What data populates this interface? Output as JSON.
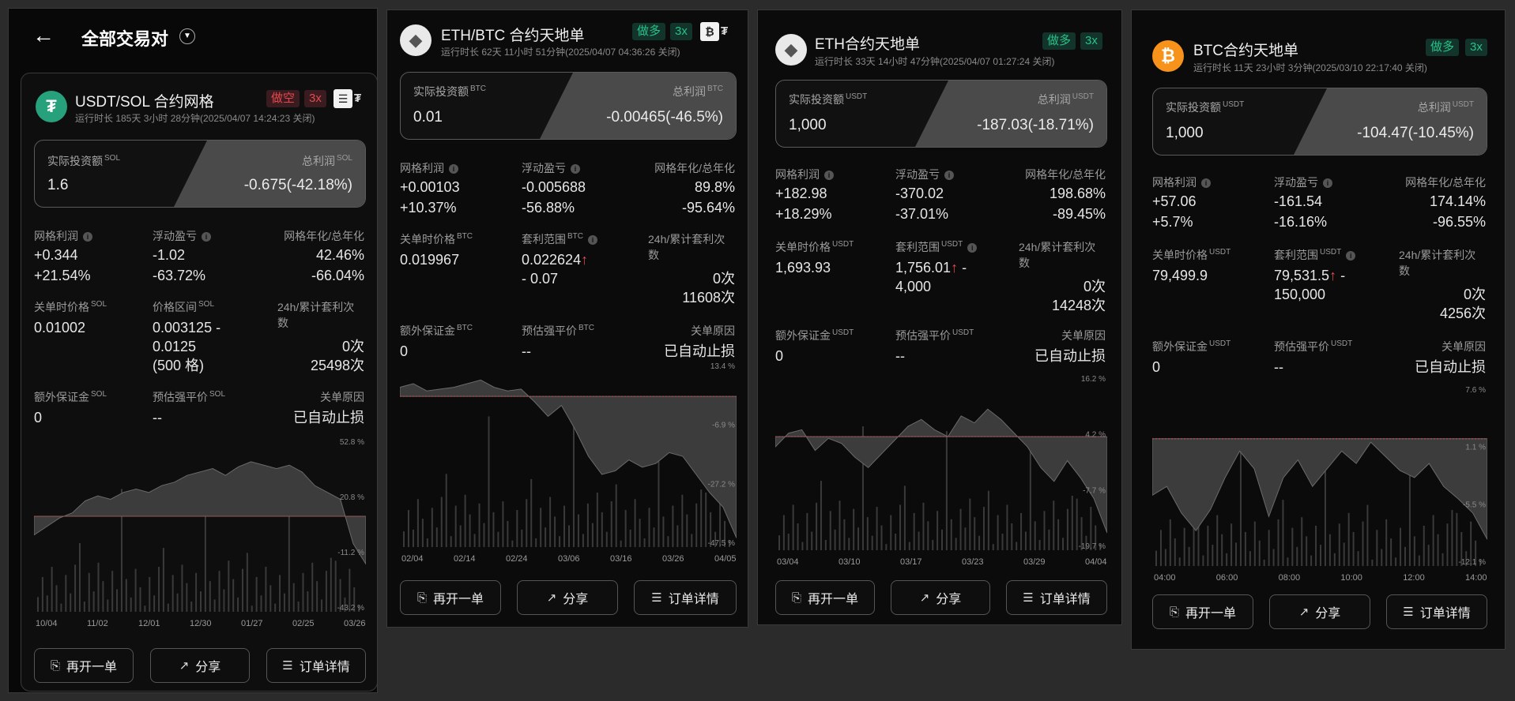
{
  "header": {
    "back_icon": "arrow-left-icon",
    "title": "全部交易对",
    "dropdown_icon": "caret-down-icon"
  },
  "cards": [
    {
      "pair": "USDT/SOL 合约网格",
      "runtime": "运行时长 185天 3小时 28分钟(2025/04/07 14:24:23 关闭)",
      "direction": "做空",
      "leverage": "3x",
      "invest_label": "实际投资额",
      "invest_unit": "SOL",
      "invest_value": "1.6",
      "profit_label": "总利润",
      "profit_unit": "SOL",
      "profit_value": "-0.675(-42.18%)",
      "grid_profit_label": "网格利润",
      "grid_profit_1": "+0.344",
      "grid_profit_2": "+21.54%",
      "float_label": "浮动盈亏",
      "float_1": "-1.02",
      "float_2": "-63.72%",
      "annual_label": "网格年化/总年化",
      "annual_1": "42.46%",
      "annual_2": "-66.04%",
      "close_price_label": "关单时价格",
      "close_price_unit": "SOL",
      "close_price": "0.01002",
      "range_label": "价格区间",
      "range_unit": "SOL",
      "range_1": "0.003125 -",
      "range_2": "0.0125",
      "range_3": "(500 格)",
      "arb_label": "24h/累计套利次数",
      "arb_1": "0次",
      "arb_2": "25498次",
      "margin_label": "额外保证金",
      "margin_unit": "SOL",
      "margin_value": "0",
      "liq_label": "预估强平价",
      "liq_unit": "SOL",
      "liq_value": "--",
      "reason_label": "关单原因",
      "reason_value": "已自动止损",
      "y_ticks": [
        "52.8 %",
        "20.8 %",
        "-11.2 %",
        "-43.2 %"
      ],
      "x_ticks": [
        "10/04",
        "11/02",
        "12/01",
        "12/30",
        "01/27",
        "02/25",
        "03/26"
      ],
      "btn_reopen": "再开一单",
      "btn_share": "分享",
      "btn_detail": "订单详情"
    },
    {
      "pair": "ETH/BTC 合约天地单",
      "runtime": "运行时长 62天 11小时 51分钟(2025/04/07 04:36:26 关闭)",
      "direction": "做多",
      "leverage": "3x",
      "invest_label": "实际投资额",
      "invest_unit": "BTC",
      "invest_value": "0.01",
      "profit_label": "总利润",
      "profit_unit": "BTC",
      "profit_value": "-0.00465(-46.5%)",
      "grid_profit_label": "网格利润",
      "grid_profit_1": "+0.00103",
      "grid_profit_2": "+10.37%",
      "float_label": "浮动盈亏",
      "float_1": "-0.005688",
      "float_2": "-56.88%",
      "annual_label": "网格年化/总年化",
      "annual_1": "89.8%",
      "annual_2": "-95.64%",
      "close_price_label": "关单时价格",
      "close_price_unit": "BTC",
      "close_price": "0.019967",
      "range_label": "套利范围",
      "range_unit": "BTC",
      "range_1": "0.022624",
      "range_2": "- 0.07",
      "arb_label": "24h/累计套利次数",
      "arb_1": "0次",
      "arb_2": "11608次",
      "margin_label": "额外保证金",
      "margin_unit": "BTC",
      "margin_value": "0",
      "liq_label": "预估强平价",
      "liq_unit": "BTC",
      "liq_value": "--",
      "reason_label": "关单原因",
      "reason_value": "已自动止损",
      "y_ticks": [
        "13.4 %",
        "-6.9 %",
        "-27.2 %",
        "-47.5 %"
      ],
      "x_ticks": [
        "02/04",
        "02/14",
        "02/24",
        "03/06",
        "03/16",
        "03/26",
        "04/05"
      ],
      "btn_reopen": "再开一单",
      "btn_share": "分享",
      "btn_detail": "订单详情"
    },
    {
      "pair": "ETH合约天地单",
      "runtime": "运行时长 33天 14小时 47分钟(2025/04/07 01:27:24 关闭)",
      "direction": "做多",
      "leverage": "3x",
      "invest_label": "实际投资额",
      "invest_unit": "USDT",
      "invest_value": "1,000",
      "profit_label": "总利润",
      "profit_unit": "USDT",
      "profit_value": "-187.03(-18.71%)",
      "grid_profit_label": "网格利润",
      "grid_profit_1": "+182.98",
      "grid_profit_2": "+18.29%",
      "float_label": "浮动盈亏",
      "float_1": "-370.02",
      "float_2": "-37.01%",
      "annual_label": "网格年化/总年化",
      "annual_1": "198.68%",
      "annual_2": "-89.45%",
      "close_price_label": "关单时价格",
      "close_price_unit": "USDT",
      "close_price": "1,693.93",
      "range_label": "套利范围",
      "range_unit": "USDT",
      "range_1": "1,756.01",
      "range_2": "4,000",
      "arb_label": "24h/累计套利次数",
      "arb_1": "0次",
      "arb_2": "14248次",
      "margin_label": "额外保证金",
      "margin_unit": "USDT",
      "margin_value": "0",
      "liq_label": "预估强平价",
      "liq_unit": "USDT",
      "liq_value": "--",
      "reason_label": "关单原因",
      "reason_value": "已自动止损",
      "y_ticks": [
        "16.2 %",
        "4.2 %",
        "-7.7 %",
        "-19.7 %"
      ],
      "x_ticks": [
        "03/04",
        "03/10",
        "03/17",
        "03/23",
        "03/29",
        "04/04"
      ],
      "btn_reopen": "再开一单",
      "btn_share": "分享",
      "btn_detail": "订单详情"
    },
    {
      "pair": "BTC合约天地单",
      "runtime": "运行时长 11天 23小时 3分钟(2025/03/10 22:17:40 关闭)",
      "direction": "做多",
      "leverage": "3x",
      "invest_label": "实际投资额",
      "invest_unit": "USDT",
      "invest_value": "1,000",
      "profit_label": "总利润",
      "profit_unit": "USDT",
      "profit_value": "-104.47(-10.45%)",
      "grid_profit_label": "网格利润",
      "grid_profit_1": "+57.06",
      "grid_profit_2": "+5.7%",
      "float_label": "浮动盈亏",
      "float_1": "-161.54",
      "float_2": "-16.16%",
      "annual_label": "网格年化/总年化",
      "annual_1": "174.14%",
      "annual_2": "-96.55%",
      "close_price_label": "关单时价格",
      "close_price_unit": "USDT",
      "close_price": "79,499.9",
      "range_label": "套利范围",
      "range_unit": "USDT",
      "range_1": "79,531.5",
      "range_2": "150,000",
      "arb_label": "24h/累计套利次数",
      "arb_1": "0次",
      "arb_2": "4256次",
      "margin_label": "额外保证金",
      "margin_unit": "USDT",
      "margin_value": "0",
      "liq_label": "预估强平价",
      "liq_unit": "USDT",
      "liq_value": "--",
      "reason_label": "关单原因",
      "reason_value": "已自动止损",
      "y_ticks": [
        "7.6 %",
        "1.1 %",
        "-5.5 %",
        "-12.1 %"
      ],
      "x_ticks": [
        "04:00",
        "06:00",
        "08:00",
        "10:00",
        "12:00",
        "14:00"
      ],
      "btn_reopen": "再开一单",
      "btn_share": "分享",
      "btn_detail": "订单详情"
    }
  ],
  "colors": {
    "background": "#2b2b2b",
    "card": "#0b0b0b",
    "short": "#e5484d",
    "long": "#29c28a",
    "zero_line": "#c24a4a"
  }
}
